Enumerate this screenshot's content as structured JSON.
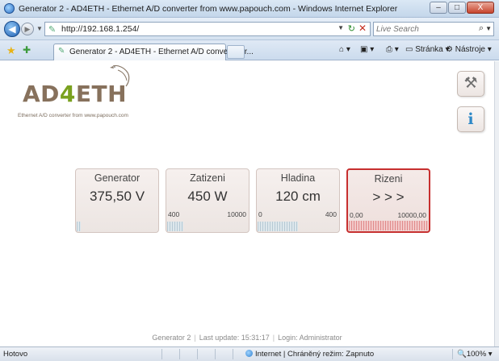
{
  "window": {
    "title": "Generator 2 - AD4ETH - Ethernet A/D converter from www.papouch.com - Windows Internet Explorer",
    "minimize": "–",
    "maximize": "□",
    "close": "X"
  },
  "address_bar": {
    "back": "◀",
    "forward": "▶",
    "url": "http://192.168.1.254/",
    "search_placeholder": "Live Search"
  },
  "tabs": [
    {
      "label": "Generator 2 - AD4ETH - Ethernet A/D converter fr..."
    }
  ],
  "command_bar": {
    "page_menu": "Stránka",
    "tools_menu": "Nástroje"
  },
  "logo": {
    "text_left": "AD",
    "text_mid": "4",
    "text_right": "ETH",
    "tagline": "Ethernet A/D converter from www.papouch.com"
  },
  "tool_buttons": {
    "info_glyph": "i",
    "settings_glyph": "⚒"
  },
  "cards": [
    {
      "name": "Generator",
      "value": "375,50 V",
      "min": "",
      "max": "",
      "level": 0.05,
      "active": false
    },
    {
      "name": "Zatizeni",
      "value": "450 W",
      "min": "400",
      "max": "10000",
      "level": 0.2,
      "active": false
    },
    {
      "name": "Hladina",
      "value": "120 cm",
      "min": "0",
      "max": "400",
      "level": 0.5,
      "active": false
    },
    {
      "name": "Rizeni",
      "value": "> > >",
      "min": "0,00",
      "max": "10000,00",
      "level": 1.0,
      "active": true
    }
  ],
  "footer": {
    "device": "Generator 2",
    "update": "Last update: 15:31:17",
    "login": "Login: Administrator"
  },
  "statusbar": {
    "done": "Hotovo",
    "zone": "Internet | Chráněný režim: Zapnuto",
    "zoom": "100%"
  }
}
